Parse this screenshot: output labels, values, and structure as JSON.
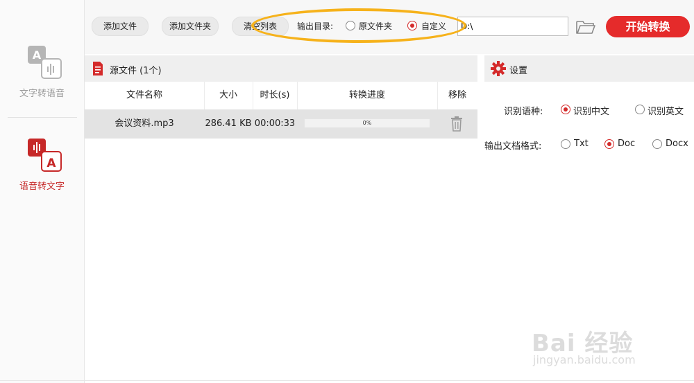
{
  "sidebar": {
    "items": [
      {
        "label": "文字转语音",
        "active": false,
        "icon": "text-to-speech-icon"
      },
      {
        "label": "语音转文字",
        "active": true,
        "icon": "speech-to-text-icon"
      }
    ]
  },
  "toolbar": {
    "add_file": "添加文件",
    "add_folder": "添加文件夹",
    "clear_list": "清空列表",
    "output_dir_label": "输出目录:",
    "option_source_folder": "原文件夹",
    "option_custom": "自定义",
    "selected_option": "自定义",
    "path_value": "D:\\",
    "folder_icon": "folder-open-icon",
    "start_label": "开始转换"
  },
  "source_panel": {
    "title": "源文件 (1个)",
    "columns": [
      "文件名称",
      "大小",
      "时长(s)",
      "转换进度",
      "移除"
    ],
    "rows": [
      {
        "name": "会议资料.mp3",
        "size": "286.41 KB",
        "duration": "00:00:33",
        "progress": "0%",
        "progress_value": 0
      }
    ]
  },
  "settings": {
    "title": "设置",
    "language_label": "识别语种:",
    "language_options": [
      "识别中文",
      "识别英文"
    ],
    "language_selected": "识别中文",
    "format_label": "输出文档格式:",
    "format_options": [
      "Txt",
      "Doc",
      "Docx"
    ],
    "format_selected": "Doc"
  },
  "watermark": {
    "main": "Bai 经验",
    "sub": "jingyan.baidu.com"
  },
  "colors": {
    "accent": "#e52b2b",
    "highlight": "#f6b21b"
  }
}
